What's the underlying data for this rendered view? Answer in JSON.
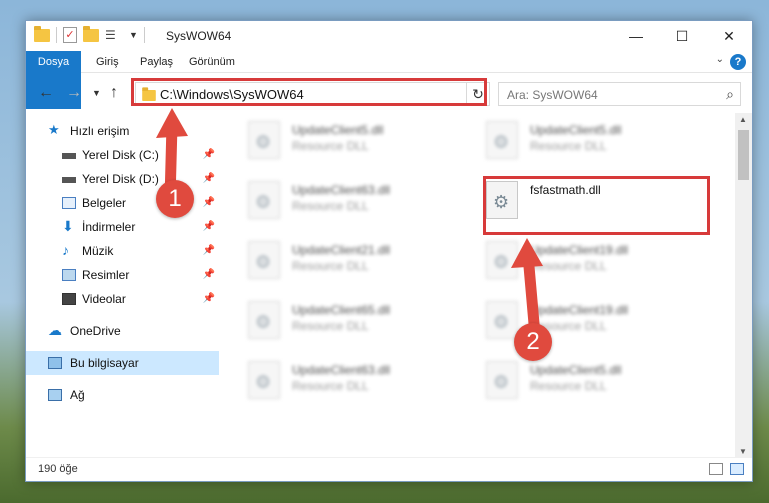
{
  "window": {
    "title": "SysWOW64"
  },
  "ribbon": {
    "tabs": [
      "Dosya",
      "Giriş",
      "Paylaş",
      "Görünüm"
    ]
  },
  "address": {
    "path": "C:\\Windows\\SysWOW64"
  },
  "search": {
    "placeholder": "Ara: SysWOW64"
  },
  "sidebar": {
    "items": [
      {
        "label": "Hızlı erişim",
        "icon": "star-icon"
      },
      {
        "label": "Yerel Disk (C:)",
        "icon": "drive-icon"
      },
      {
        "label": "Yerel Disk (D:)",
        "icon": "drive-icon"
      },
      {
        "label": "Belgeler",
        "icon": "documents-icon"
      },
      {
        "label": "İndirmeler",
        "icon": "download-icon"
      },
      {
        "label": "Müzik",
        "icon": "music-icon"
      },
      {
        "label": "Resimler",
        "icon": "pictures-icon"
      },
      {
        "label": "Videolar",
        "icon": "video-icon"
      },
      {
        "label": "OneDrive",
        "icon": "cloud-icon"
      },
      {
        "label": "Bu bilgisayar",
        "icon": "computer-icon"
      },
      {
        "label": "Ağ",
        "icon": "network-icon"
      }
    ]
  },
  "files": [
    {
      "name": "UpdateClient5.dll",
      "type": "Resource DLL"
    },
    {
      "name": "UpdateClient5.dll",
      "type": "Resource DLL"
    },
    {
      "name": "UpdateClient63.dll",
      "type": "Resource DLL"
    },
    {
      "name": "fsfastmath.dll",
      "type": ""
    },
    {
      "name": "UpdateClient21.dll",
      "type": "Resource DLL"
    },
    {
      "name": "UpdateClient19.dll",
      "type": "Resource DLL"
    },
    {
      "name": "UpdateClient65.dll",
      "type": "Resource DLL"
    },
    {
      "name": "UpdateClient19.dll",
      "type": "Resource DLL"
    },
    {
      "name": "UpdateClient63.dll",
      "type": "Resource DLL"
    },
    {
      "name": "UpdateClient5.dll",
      "type": "Resource DLL"
    }
  ],
  "status": {
    "count": "190 öğe"
  },
  "annotations": {
    "badge1": "1",
    "badge2": "2"
  },
  "colors": {
    "accent": "#1979ca",
    "highlight": "#d73a3a",
    "selected": "#cce8ff"
  }
}
